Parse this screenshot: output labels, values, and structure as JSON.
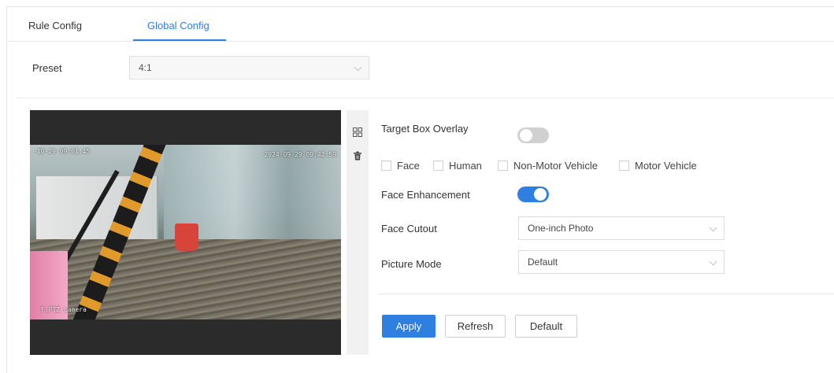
{
  "tabs": [
    {
      "label": "Rule Config",
      "active": false
    },
    {
      "label": "Global Config",
      "active": true
    }
  ],
  "preset": {
    "label": "Preset",
    "value": "4:1"
  },
  "video": {
    "osd_top_left": "-10-29 09:01:45",
    "osd_top_right": "2024-09-29 09:42:59",
    "osd_bottom_left": "F.PTZ camera"
  },
  "tools": {
    "grid_icon": "grid-icon",
    "delete_icon": "trash-icon"
  },
  "target_box_overlay": {
    "label": "Target Box Overlay",
    "enabled": false
  },
  "targets": [
    {
      "label": "Face",
      "checked": false
    },
    {
      "label": "Human",
      "checked": false
    },
    {
      "label": "Non-Motor Vehicle",
      "checked": false
    },
    {
      "label": "Motor Vehicle",
      "checked": false
    }
  ],
  "face_enhancement": {
    "label": "Face Enhancement",
    "enabled": true
  },
  "face_cutout": {
    "label": "Face Cutout",
    "value": "One-inch Photo"
  },
  "picture_mode": {
    "label": "Picture Mode",
    "value": "Default"
  },
  "buttons": {
    "apply": "Apply",
    "refresh": "Refresh",
    "default": "Default"
  },
  "colors": {
    "accent": "#2f7fe1",
    "toggle_off": "#d0d0d0"
  }
}
